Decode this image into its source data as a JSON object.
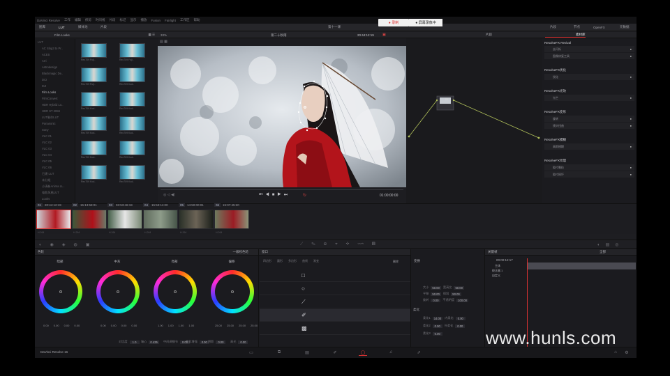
{
  "menubar": {
    "items": [
      "DaVinci Resolve",
      "工作",
      "编辑",
      "修剪",
      "时间线",
      "片段",
      "标记",
      "显示",
      "播放",
      "Fusion",
      "Fairlight",
      "工作区",
      "帮助"
    ]
  },
  "recording": {
    "record_label": "● 录制",
    "status_label": "● 屏幕录像中"
  },
  "toolbar": {
    "left": [
      "图库",
      "LUT",
      "媒体池",
      "片段"
    ],
    "project_title": "第十一课",
    "right": [
      "片段",
      "节点",
      "OpenFX",
      "元数据"
    ]
  },
  "lut_panel": {
    "header": "Film Looks",
    "tree": [
      "LUT",
      "AC Slog3 to Pr..",
      "ACES",
      "Arri",
      "Astrodesign",
      "Blackmagic De..",
      "DCI",
      "DJI",
      "Film Looks",
      "FilmConvert",
      "HDR Hybrid Lo..",
      "HDR ST 2084",
      "LUT制作LUT",
      "Panasonic",
      "Sony",
      "VLC 01",
      "VLC 02",
      "VLC 03",
      "VLC 04",
      "VLC 05",
      "VLC 06",
      "已建 LUT",
      "未分组",
      "小清新Anima LL..",
      "电影风格LUT",
      "Looks"
    ],
    "active_index": 8
  },
  "thumbnails": {
    "labels": [
      "Rec709 Fuji..",
      "Rec709 Fuji..",
      "Rec709 Fuji..",
      "Rec709 Kod..",
      "Rec709 Kod..",
      "Rec709 Kod..",
      "Rec709 Kod..",
      "Rec709 Kod..",
      "Rec709 Kod..",
      "Rec709 Kod..",
      "Rec709 Kod..",
      "Rec709 Kod.."
    ]
  },
  "viewer": {
    "zoom": "33%",
    "clip_name": "第二十秋雨",
    "timecode": "20:44:12:19",
    "timecode_bottom": "01:00:00:00"
  },
  "nodes": {
    "header": "片段",
    "node_label": "01"
  },
  "effects": {
    "tab": "素材库",
    "sections": [
      {
        "title": "ResolveFX Revival",
        "items": [
          "去闪烁",
          "图像修复工具"
        ]
      },
      {
        "title": "ResolveFX优化",
        "items": [
          "锐化"
        ]
      },
      {
        "title": "ResolveFX光效",
        "items": [
          "光芒"
        ]
      },
      {
        "title": "ResolveFX变形",
        "items": [
          "旋转",
          "镜头扭曲"
        ]
      },
      {
        "title": "ResolveFX模糊",
        "items": [
          "高斯模糊"
        ]
      },
      {
        "title": "ResolveFX纹理",
        "items": [
          "胶片颗粒",
          "胶片损坏"
        ]
      }
    ]
  },
  "timeline_clips": {
    "entries": [
      {
        "num": "01",
        "tc": "20:44:12:19",
        "codec": "H.264"
      },
      {
        "num": "02",
        "tc": "15:13:58:01",
        "codec": "H.264"
      },
      {
        "num": "03",
        "tc": "03:53:46:19",
        "codec": "H.264"
      },
      {
        "num": "04",
        "tc": "15:53:11:00",
        "codec": "H.264"
      },
      {
        "num": "05",
        "tc": "14:50:00:01",
        "codec": "H.264"
      },
      {
        "num": "06",
        "tc": "15:07:45:20",
        "codec": "H.264"
      }
    ]
  },
  "color_wheels": {
    "header": "色轮",
    "mode": "一级校色轮",
    "wheels": [
      {
        "title": "暗部",
        "vals": [
          "0.00",
          "0.00",
          "0.00",
          "0.00"
        ]
      },
      {
        "title": "中灰",
        "vals": [
          "0.00",
          "0.00",
          "0.00",
          "0.00"
        ]
      },
      {
        "title": "亮部",
        "vals": [
          "1.00",
          "1.00",
          "1.00",
          "1.00"
        ]
      },
      {
        "title": "偏移",
        "vals": [
          "25.00",
          "25.00",
          "25.00",
          "25.00"
        ]
      }
    ],
    "bottom": [
      {
        "k": "对比度",
        "v": "1.0"
      },
      {
        "k": "轴心",
        "v": "0.435"
      },
      {
        "k": "中间调细节",
        "v": "0.00"
      },
      {
        "k": "色彩增强",
        "v": "0.00"
      },
      {
        "k": "阴影",
        "v": "0.00"
      },
      {
        "k": "高光",
        "v": "0.00"
      }
    ]
  },
  "window_panel": {
    "header": "窗口",
    "row_labels": [
      "四边形",
      "圆形",
      "多边形",
      "曲线",
      "渐变"
    ],
    "actions": [
      "四边形",
      "圆形",
      "多边形",
      "曲线",
      "渐变"
    ],
    "delete_label": "删除"
  },
  "transform": {
    "title": "变换",
    "rows": [
      [
        "大小",
        "50.00",
        "宽高比",
        "50.00"
      ],
      [
        "平移",
        "50.00",
        "倾斜",
        "50.00"
      ],
      [
        "旋转",
        "0.00",
        "不透明度",
        "100.00"
      ]
    ],
    "soft_title": "柔化",
    "soft_rows": [
      [
        "柔化1",
        "14.00",
        "内柔化",
        "0.00"
      ],
      [
        "柔化2",
        "0.00",
        "外柔化",
        "0.00"
      ],
      [
        "柔化3",
        "0.00"
      ]
    ]
  },
  "keyframes": {
    "header": "关键帧",
    "filter": "全部",
    "timecode": "00:00:12:17",
    "rows": [
      "主体",
      "校正器 1",
      "自定义"
    ]
  },
  "bottom_bar": {
    "app_name": "DaVinci Resolve 16"
  },
  "watermark": "www.hunls.com"
}
